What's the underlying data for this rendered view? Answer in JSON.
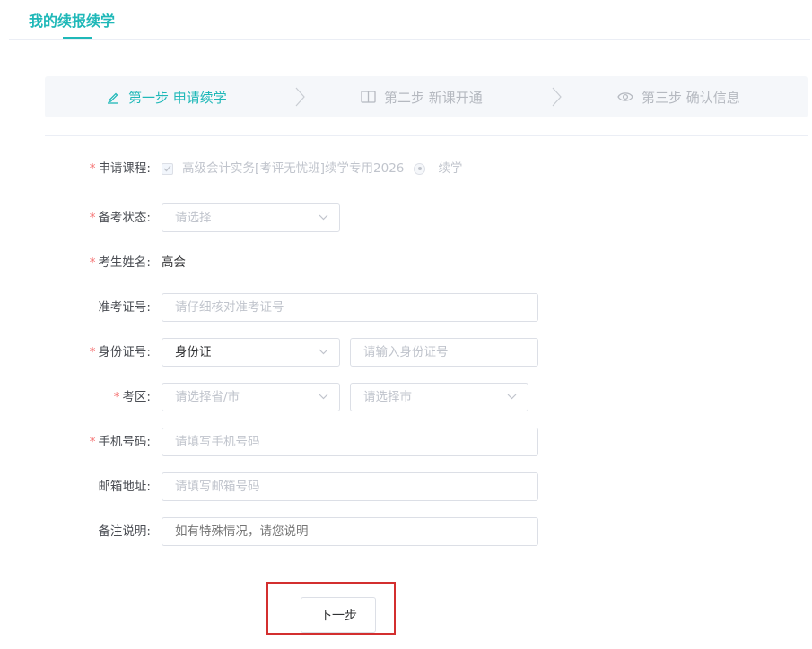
{
  "page": {
    "title": "我的续报续学"
  },
  "steps": [
    {
      "label": "第一步 申请续学",
      "icon": "pencil-icon",
      "active": true
    },
    {
      "label": "第二步 新课开通",
      "icon": "book-icon",
      "active": false
    },
    {
      "label": "第三步 确认信息",
      "icon": "eye-icon",
      "active": false
    }
  ],
  "form": {
    "course": {
      "label": "申请课程:",
      "option": "高级会计实务[考评无忧班]续学专用2026",
      "radio": "续学"
    },
    "exam_status": {
      "label": "备考状态:",
      "placeholder": "请选择"
    },
    "name": {
      "label": "考生姓名:",
      "value": "高会"
    },
    "admission_no": {
      "label": "准考证号:",
      "placeholder": "请仔细核对准考证号"
    },
    "id": {
      "label": "身份证号:",
      "type_value": "身份证",
      "placeholder": "请输入身份证号"
    },
    "region": {
      "label": "考区:",
      "province_placeholder": "请选择省/市",
      "city_placeholder": "请选择市"
    },
    "phone": {
      "label": "手机号码:",
      "placeholder": "请填写手机号码"
    },
    "email": {
      "label": "邮箱地址:",
      "placeholder": "请填写邮箱号码"
    },
    "remark": {
      "label": "备注说明:",
      "placeholder": "如有特殊情况，请您说明"
    }
  },
  "actions": {
    "next": "下一步"
  },
  "colors": {
    "accent": "#1fb8b8",
    "required": "#f56c6c",
    "highlight": "#d32f2f"
  }
}
